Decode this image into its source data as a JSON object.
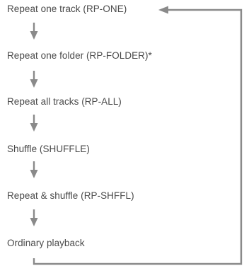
{
  "diagram": {
    "steps": [
      "Repeat one track (RP-ONE)",
      "Repeat one folder (RP-FOLDER)*",
      "Repeat all tracks (RP-ALL)",
      "Shuffle (SHUFFLE)",
      "Repeat & shuffle (RP-SHFFL)",
      "Ordinary playback"
    ],
    "arrow_color": "#8a8a8a",
    "text_color": "#4a4a4a"
  }
}
